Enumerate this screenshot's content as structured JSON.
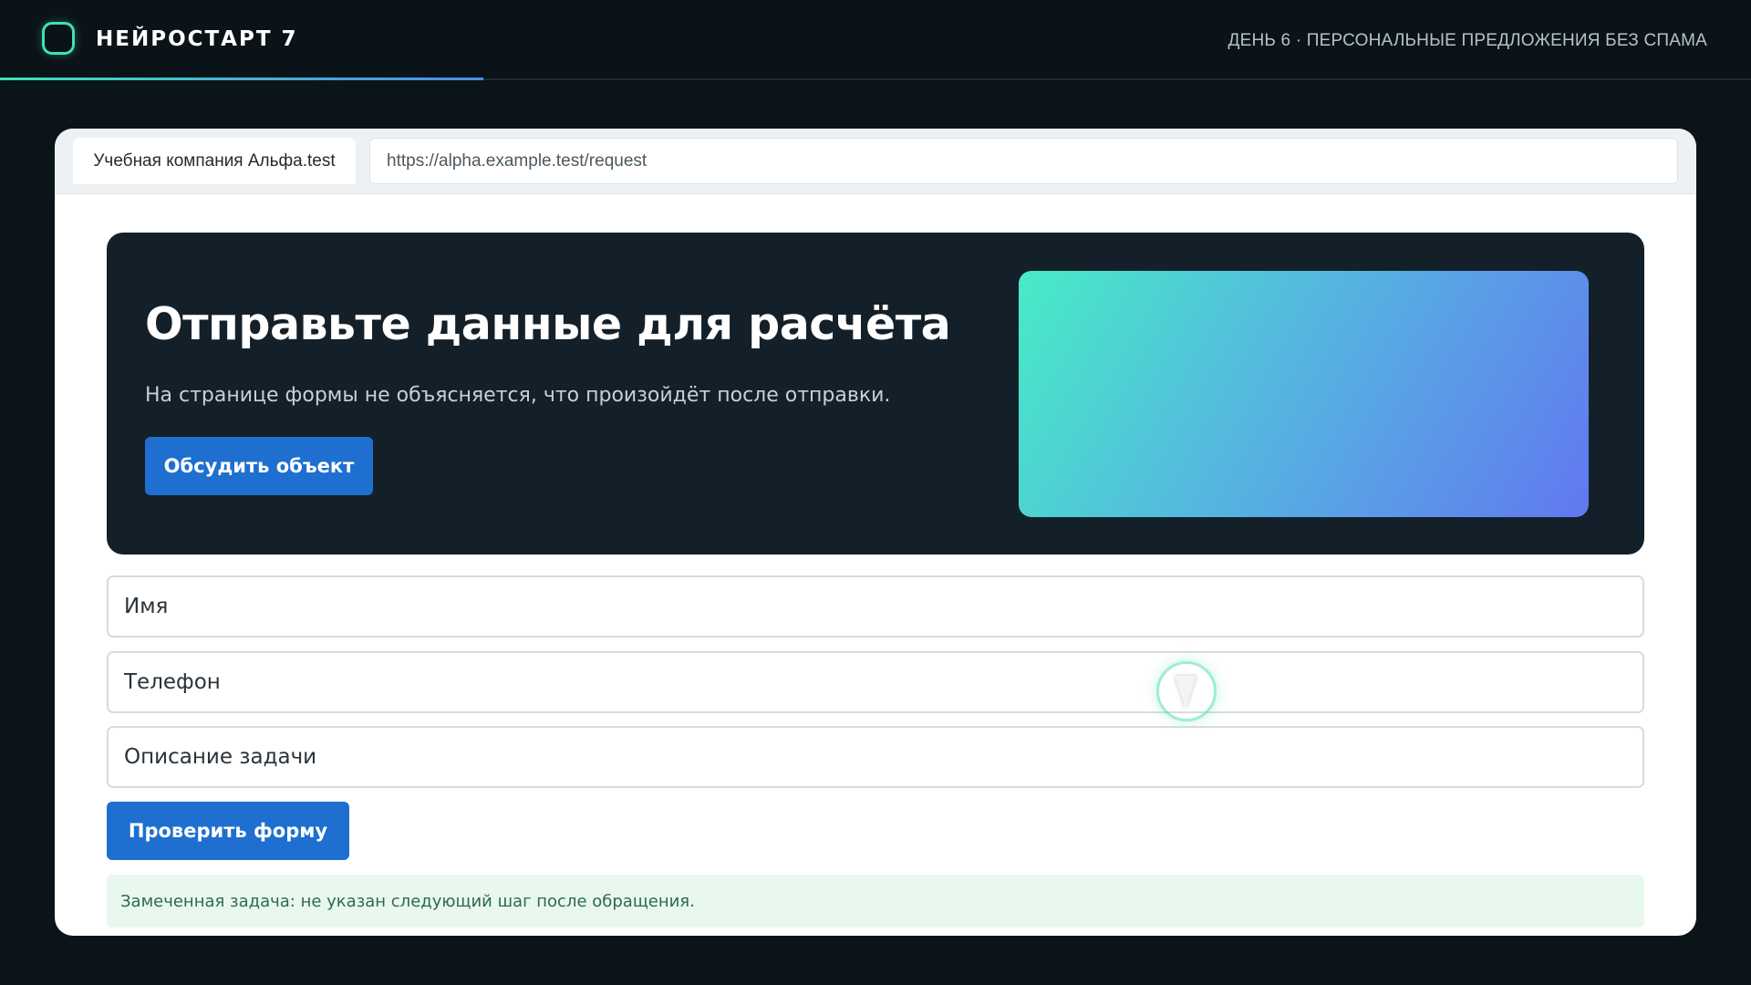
{
  "header": {
    "brand": "НЕЙРОСТАРТ 7",
    "caption": "ДЕНЬ 6 · ПЕРСОНАЛЬНЫЕ ПРЕДЛОЖЕНИЯ БЕЗ СПАМА",
    "logo_icon": "rounded-square-logo-icon"
  },
  "browser": {
    "tab_label": "Учебная компания Альфа.test",
    "url": "https://alpha.example.test/request"
  },
  "hero": {
    "title": "Отправьте данные для расчёта",
    "subtitle": "На странице формы не объясняется, что произойдёт после отправки.",
    "cta_label": "Обсудить объект"
  },
  "form": {
    "name_placeholder": "Имя",
    "phone_placeholder": "Телефон",
    "description_placeholder": "Описание задачи",
    "submit_label": "Проверить форму"
  },
  "notice": {
    "text": "Замеченная задача: не указан следующий шаг после обращения."
  },
  "colors": {
    "accent_teal": "#3fe0b8",
    "primary_button": "#1e6fd0",
    "hero_background": "#142029",
    "page_background": "#0b1419",
    "notice_background": "#e8f8ef"
  }
}
